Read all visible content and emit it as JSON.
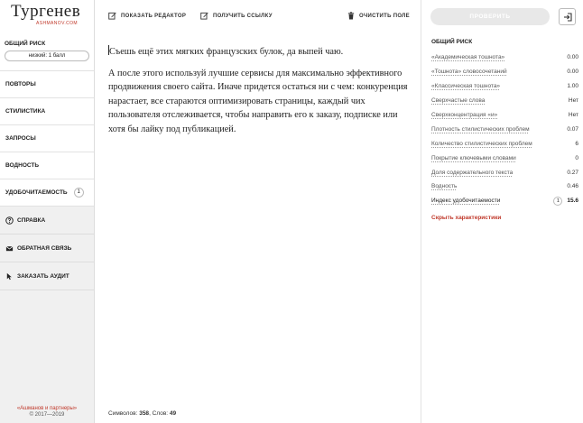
{
  "logo": {
    "title": "Тургенев",
    "subtitle": "ASHMANOV.COM"
  },
  "risk": {
    "label": "ОБЩИЙ РИСК",
    "value": "низкий: 1 балл"
  },
  "nav": [
    {
      "label": "ПОВТОРЫ"
    },
    {
      "label": "СТИЛИСТИКА"
    },
    {
      "label": "ЗАПРОСЫ"
    },
    {
      "label": "ВОДНОСТЬ"
    },
    {
      "label": "УДОБОЧИТАЕМОСТЬ",
      "badge": "1"
    }
  ],
  "secondary_nav": [
    {
      "label": "СПРАВКА",
      "icon": "help-icon"
    },
    {
      "label": "ОБРАТНАЯ СВЯЗЬ",
      "icon": "mail-icon"
    },
    {
      "label": "ЗАКАЗАТЬ АУДИТ",
      "icon": "cursor-icon"
    }
  ],
  "footer": {
    "link": "«Ашманов и партнеры»",
    "copyright": "© 2017—2019"
  },
  "toolbar": {
    "show_editor": "ПОКАЗАТЬ РЕДАКТОР",
    "get_link": "ПОЛУЧИТЬ ССЫЛКУ",
    "clear_field": "ОЧИСТИТЬ ПОЛЕ"
  },
  "editor": {
    "paragraph1": "Съешь ещё этих мягких французских булок, да выпей чаю.",
    "paragraph2": "А после этого используй лучшие сервисы для максимально эффективного продвижения своего сайта. Иначе придется остаться ни с чем: конкуренция нарастает, все стараются оптимизировать страницы, каждый чих пользователя отслеживается, чтобы направить его к заказу, подписке или хотя бы лайку под публикацией."
  },
  "counts": {
    "chars_label": "Символов:",
    "chars": "358",
    "words_label": ", Слов:",
    "words": "49"
  },
  "panel": {
    "check_button": "ПРОВЕРИТЬ",
    "title": "ОБЩИЙ РИСК",
    "metrics": [
      {
        "label": "«Академическая тошнота»",
        "value": "0.00"
      },
      {
        "label": "«Тошнота» словосочетаний",
        "value": "0.00"
      },
      {
        "label": "«Классическая тошнота»",
        "value": "1.00"
      },
      {
        "label": "Сверхчастые слова",
        "value": "Нет"
      },
      {
        "label": "Сверхконцентрация «и»",
        "value": "Нет"
      },
      {
        "label": "Плотность стилистических проблем",
        "value": "0.07"
      },
      {
        "label": "Количество стилистических проблем",
        "value": "6"
      },
      {
        "label": "Покрытие ключевыми словами",
        "value": "0"
      },
      {
        "label": "Доля содержательного текста",
        "value": "0.27"
      },
      {
        "label": "Водность",
        "value": "0.46"
      },
      {
        "label": "Индекс удобочитаемости",
        "value": "15.6",
        "badge": "1"
      }
    ],
    "hide_link": "Скрыть характеристики"
  }
}
